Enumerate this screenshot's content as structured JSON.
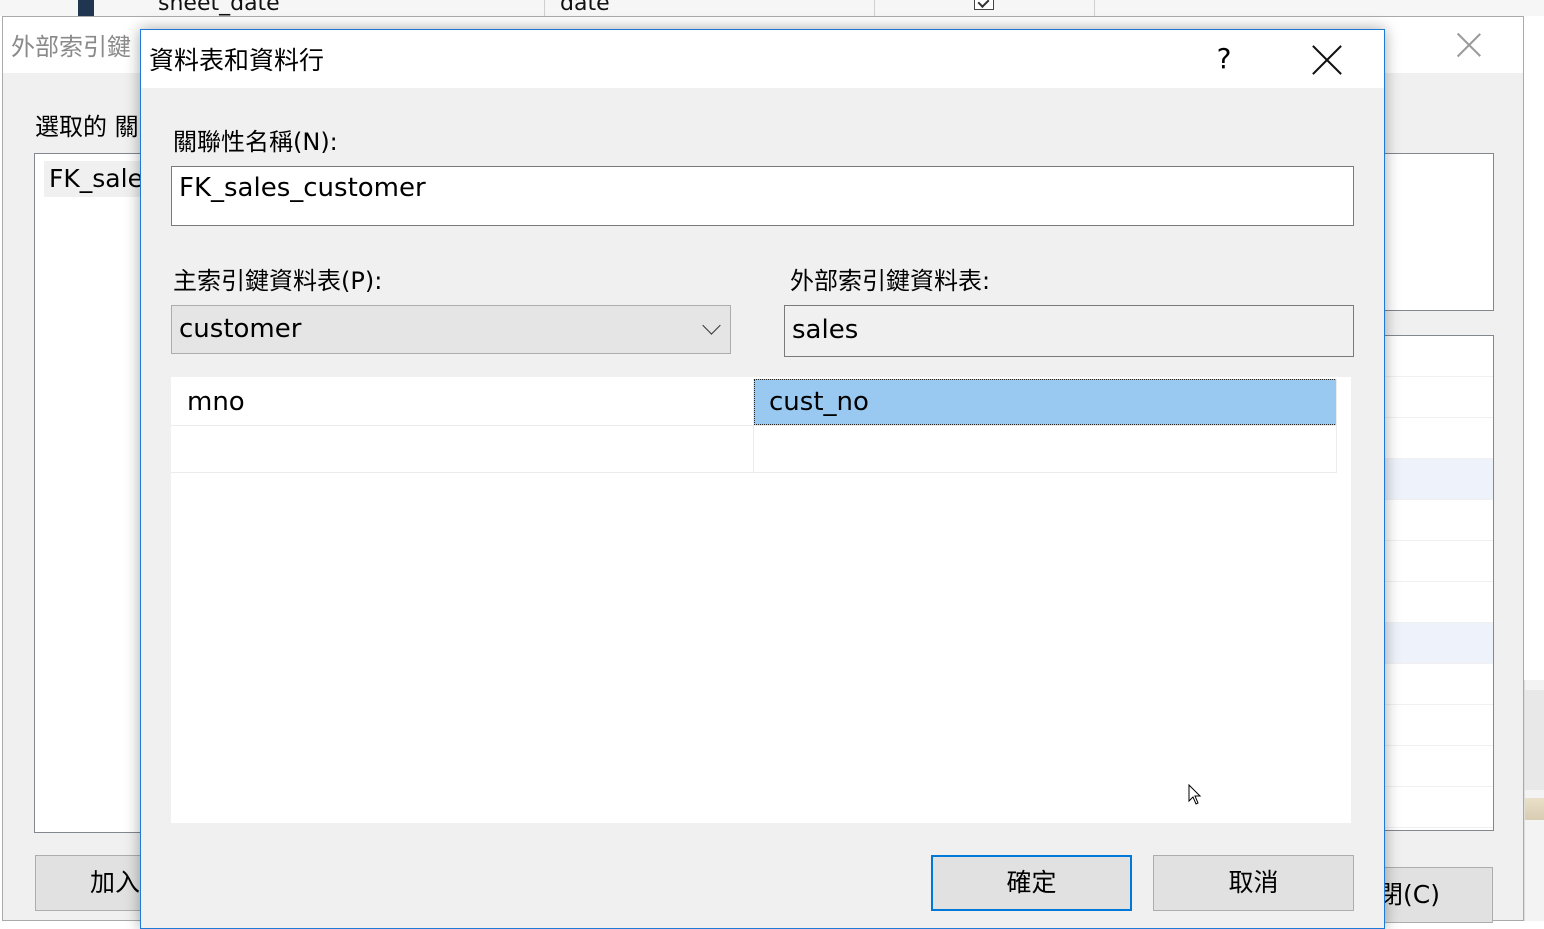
{
  "background_grid": {
    "col1": "sheet_date",
    "col2": "date"
  },
  "fk_dialog": {
    "title": "外部索引鍵",
    "selected_label": "選取的 關",
    "list_item": "FK_sale",
    "add_button": "加入",
    "close_button": "閉(C)"
  },
  "dialog": {
    "title": "資料表和資料行",
    "help_label": "?",
    "name_label": "關聯性名稱(N):",
    "name_value": "FK_sales_customer",
    "pk_table_label": "主索引鍵資料表(P):",
    "pk_table_value": "customer",
    "fk_table_label": "外部索引鍵資料表:",
    "fk_table_value": "sales",
    "mapping_rows": [
      {
        "pk_column": "mno",
        "fk_column": "cust_no"
      },
      {
        "pk_column": "",
        "fk_column": ""
      }
    ],
    "ok_button": "確定",
    "cancel_button": "取消"
  },
  "colors": {
    "accent": "#0078d7",
    "selection": "#99c9f0",
    "dialog_bg": "#f0f0f0"
  }
}
